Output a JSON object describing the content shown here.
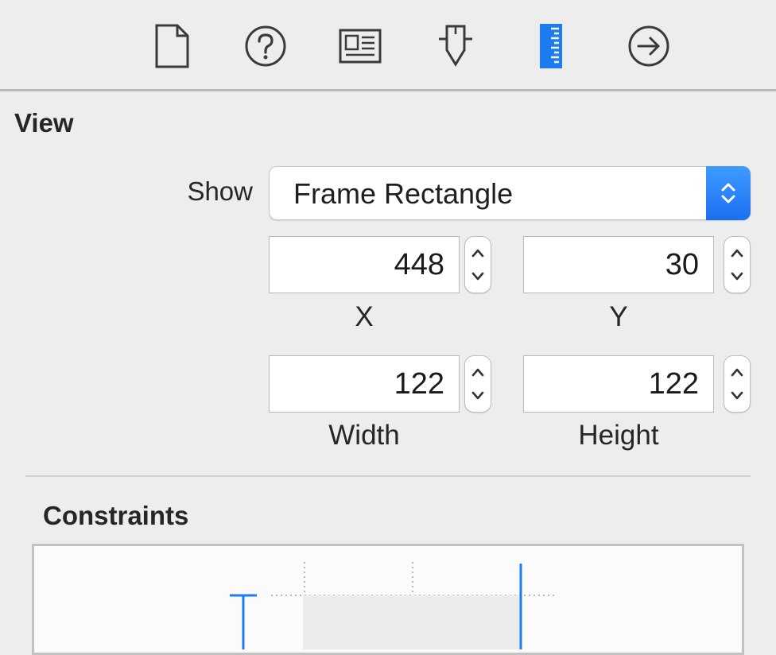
{
  "toolbar": {
    "tabs": [
      {
        "icon": "file-inspector-icon",
        "active": false
      },
      {
        "icon": "quick-help-icon",
        "active": false
      },
      {
        "icon": "identity-inspector-icon",
        "active": false
      },
      {
        "icon": "attributes-inspector-icon",
        "active": false
      },
      {
        "icon": "size-inspector-icon",
        "active": true
      },
      {
        "icon": "connections-inspector-icon",
        "active": false
      }
    ],
    "accent_color": "#1d7cf2"
  },
  "view_section": {
    "title": "View",
    "show_label": "Show",
    "show_value": "Frame Rectangle",
    "x_value": "448",
    "y_value": "30",
    "width_value": "122",
    "height_value": "122",
    "x_label": "X",
    "y_label": "Y",
    "width_label": "Width",
    "height_label": "Height"
  },
  "constraints_section": {
    "title": "Constraints",
    "constraint_color": "#1d7cf2"
  }
}
